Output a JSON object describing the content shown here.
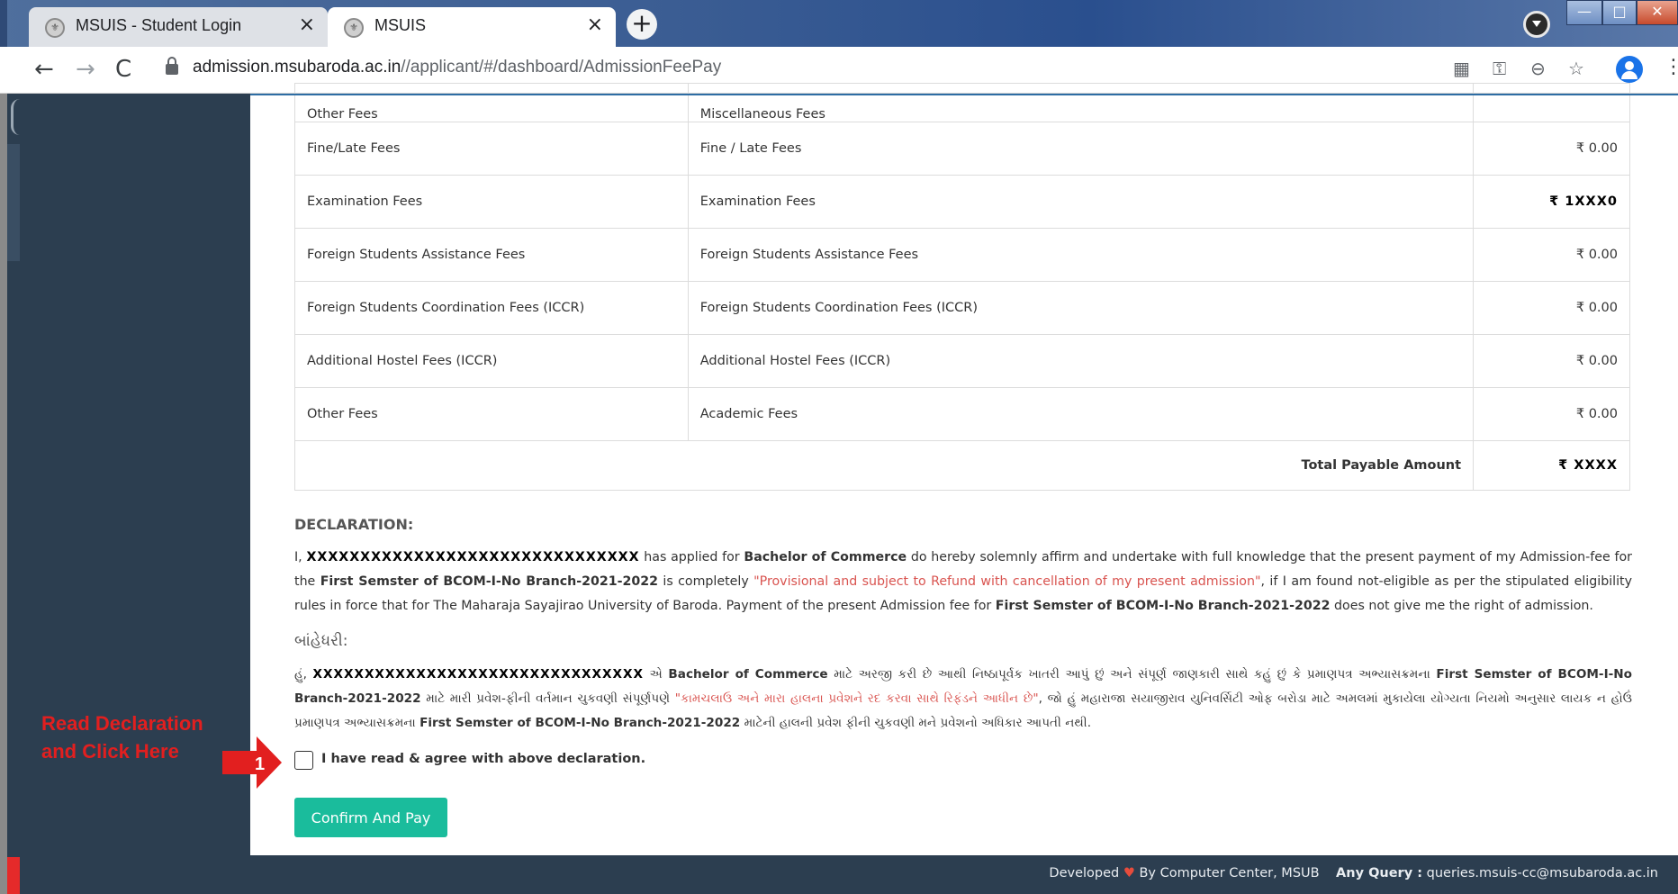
{
  "browser": {
    "tabs": [
      {
        "title": "MSUIS - Student Login",
        "close": "×"
      },
      {
        "title": "MSUIS",
        "close": "×"
      }
    ],
    "new_tab": "+",
    "url_host": "admission.msubaroda.ac.in",
    "url_path": "//applicant/#/dashboard/AdmissionFeePay",
    "nav": {
      "back": "←",
      "forward": "→",
      "reload": "C"
    },
    "icons": {
      "qr": "▦",
      "key": "⚿",
      "zoom": "⊖",
      "star": "☆",
      "menu": "⋮"
    },
    "window": {
      "minimize": "—",
      "maximize": "□",
      "close": "✕"
    }
  },
  "fees_table": {
    "rows": [
      {
        "head": "Other Fees",
        "desc": "Miscellaneous Fees",
        "amount": ""
      },
      {
        "head": "Fine/Late Fees",
        "desc": "Fine / Late Fees",
        "amount": "₹ 0.00"
      },
      {
        "head": "Examination Fees",
        "desc": "Examination Fees",
        "amount": "₹ 1XXX0"
      },
      {
        "head": "Foreign Students Assistance Fees",
        "desc": "Foreign Students Assistance Fees",
        "amount": "₹ 0.00"
      },
      {
        "head": "Foreign Students Coordination Fees (ICCR)",
        "desc": "Foreign Students Coordination Fees (ICCR)",
        "amount": "₹ 0.00"
      },
      {
        "head": "Additional Hostel Fees (ICCR)",
        "desc": "Additional Hostel Fees (ICCR)",
        "amount": "₹ 0.00"
      },
      {
        "head": "Other Fees",
        "desc": "Academic Fees",
        "amount": "₹ 0.00"
      }
    ],
    "total_label": "Total Payable Amount",
    "total_value": "₹ XXXX"
  },
  "declaration": {
    "title": "DECLARATION:",
    "en": {
      "p1": "I, ",
      "name": "XXXXXXXXXXXXXXXXXXXXXXXXXXXXXXX",
      "p2": " has applied for ",
      "course": "Bachelor of Commerce",
      "p3": " do hereby solemnly affirm and undertake with full knowledge that the present payment of my Admission-fee for the ",
      "semester": "First Semster of BCOM-I-No Branch-2021-2022",
      "p4": " is completely ",
      "provisional": "\"Provisional and subject to Refund with cancellation of my present admission\"",
      "p5": ", if I am found not-eligible as per the stipulated eligibility rules in force that for The Maharaja Sayajirao University of Baroda. Payment of the present Admission fee for ",
      "semester2": "First Semster of BCOM-I-No Branch-2021-2022",
      "p6": " does not give me the right of admission."
    },
    "gu_title": "બાંહેધરી:",
    "gu": {
      "p1": "હું, ",
      "name": "XXXXXXXXXXXXXXXXXXXXXXXXXXXXXXXX",
      "p2": " એ ",
      "course": "Bachelor of Commerce",
      "p3": " માટે અરજી કરી છે આથી નિષ્ઠાપૂર્વક ખાતરી આપું છું અને સંપૂર્ણ જાણકારી સાથે કહું છું કે પ્રમાણપત્ર અભ્યાસક્રમના ",
      "semester": "First Semster of BCOM-I-No Branch-2021-2022",
      "p4": " માટે મારી પ્રવેશ-ફીની વર્તમાન ચુકવણી સંપૂર્ણપણે ",
      "provisional": "\"કામચલાઉ અને મારા હાલના પ્રવેશને રદ કરવા સાથે રિફંડને આધીન છે\"",
      "p5": ", જો હું મહારાજા સયાજીરાવ યુનિવર્સિટી ઓફ બરોડા માટે અમલમાં મુકાયેલા યોગ્યતા નિયમો અનુસાર લાયક ન હોઉં પ્રમાણપત્ર અભ્યાસક્રમના ",
      "semester2": "First Semster of BCOM-I-No Branch-2021-2022",
      "p6": " માટેની હાલની પ્રવેશ ફીની ચુકવણી મને પ્રવેશનો અધિકાર આપતી નથી."
    }
  },
  "agree_label": "I have read & agree with above declaration.",
  "confirm_button": "Confirm And Pay",
  "annotation": {
    "line1": "Read Declaration",
    "line2": "and Click Here",
    "number": "1"
  },
  "footer": {
    "developed_prefix": "Developed ",
    "heart": "♥",
    "developed_suffix": " By Computer Center, MSUB",
    "query_label": "Any Query :",
    "query_email": " queries.msuis-cc@msubaroda.ac.in"
  },
  "colors": {
    "sidebar": "#2c3e50",
    "accent_button": "#1abc9c",
    "annotation_red": "#e21f1f",
    "provisional_text": "#d9534f"
  }
}
